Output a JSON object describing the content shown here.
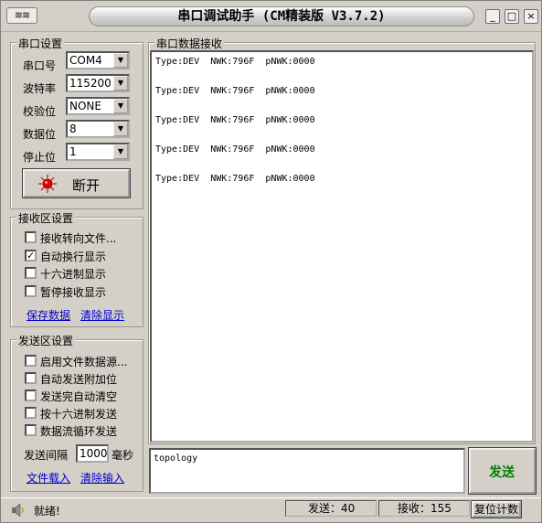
{
  "window": {
    "title": "串口调试助手 (CM精装版 V3.7.2)",
    "sys_menu_icon": "≋≋",
    "buttons": {
      "minimize": "_",
      "maximize": "□",
      "close": "×"
    }
  },
  "port_settings": {
    "title": "串口设置",
    "fields": [
      {
        "label": "串口号",
        "value": "COM4"
      },
      {
        "label": "波特率",
        "value": "115200"
      },
      {
        "label": "校验位",
        "value": "NONE"
      },
      {
        "label": "数据位",
        "value": "8"
      },
      {
        "label": "停止位",
        "value": "1"
      }
    ],
    "connect_button": {
      "label": "断开",
      "indicator_color": "#e00000"
    }
  },
  "receive_settings": {
    "title": "接收区设置",
    "options": [
      {
        "label": "接收转向文件...",
        "checked": false
      },
      {
        "label": "自动换行显示",
        "checked": true
      },
      {
        "label": "十六进制显示",
        "checked": false
      },
      {
        "label": "暂停接收显示",
        "checked": false
      }
    ],
    "save_link": "保存数据",
    "clear_link": "清除显示"
  },
  "send_settings": {
    "title": "发送区设置",
    "options": [
      {
        "label": "启用文件数据源...",
        "checked": false
      },
      {
        "label": "自动发送附加位",
        "checked": false
      },
      {
        "label": "发送完自动清空",
        "checked": false
      },
      {
        "label": "按十六进制发送",
        "checked": false
      },
      {
        "label": "数据流循环发送",
        "checked": false
      }
    ],
    "interval_label": "发送间隔",
    "interval_value": "1000",
    "interval_unit": "毫秒",
    "load_file_link": "文件载入",
    "clear_input_link": "清除输入"
  },
  "receive_area": {
    "title": "串口数据接收",
    "lines": [
      "Type:DEV  NWK:796F  pNWK:0000",
      "Type:DEV  NWK:796F  pNWK:0000",
      "Type:DEV  NWK:796F  pNWK:0000",
      "Type:DEV  NWK:796F  pNWK:0000",
      "Type:DEV  NWK:796F  pNWK:0000"
    ]
  },
  "send_area": {
    "text": "topology",
    "send_button": "发送",
    "send_button_color": "#008000"
  },
  "status": {
    "ready": "就绪!",
    "sent": "发送：40",
    "received": "接收：155",
    "reset_button": "复位计数"
  }
}
